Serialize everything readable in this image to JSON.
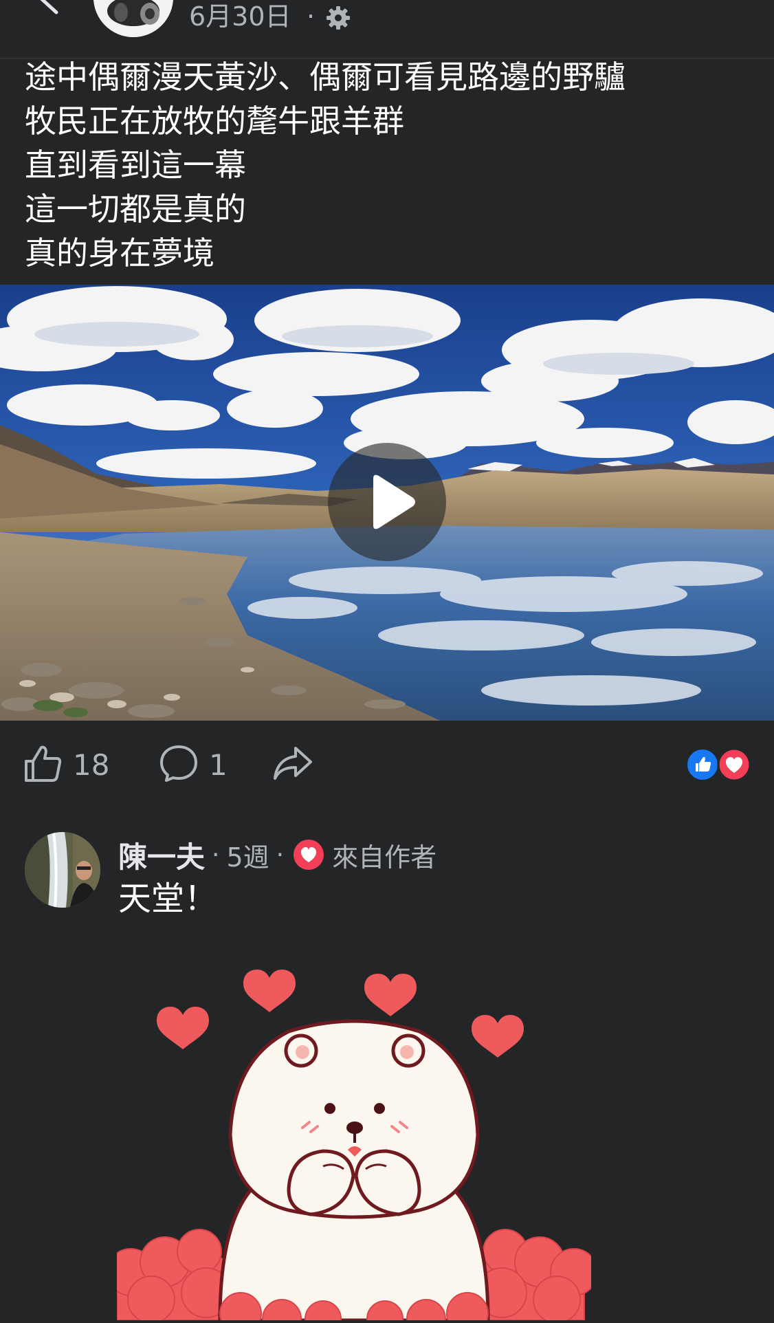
{
  "header": {
    "back_icon": "chevron-left-icon",
    "avatar_icon": "profile-avatar",
    "date": "6月30日",
    "dot": "·",
    "privacy_icon": "gear-icon"
  },
  "post": {
    "lines": [
      "途中偶爾漫天黃沙、偶爾可看見路邊的野驢",
      "牧民正在放牧的氂牛跟羊群",
      "直到看到這一幕",
      "這一切都是真的",
      "真的身在夢境"
    ]
  },
  "video": {
    "play_icon": "play-icon"
  },
  "actions": {
    "like_count": "18",
    "comment_count": "1",
    "like_icon": "thumbs-up-icon",
    "comment_icon": "comment-bubble-icon",
    "share_icon": "share-arrow-icon",
    "reaction_icons": [
      "like-reaction-icon",
      "love-reaction-icon"
    ],
    "colors": {
      "like": "#1877f2",
      "love": "#f33e58"
    }
  },
  "comment": {
    "author": "陳一夫",
    "sep1": "·",
    "time": "5週",
    "sep2": "·",
    "badge_icon": "love-heart-icon",
    "author_label": "來自作者",
    "text": "天堂！",
    "sticker_icon": "polar-bear-hearts-sticker"
  },
  "theme": {
    "background": "#242526",
    "text": "#ffffff",
    "secondary": "#b0b3b8"
  }
}
